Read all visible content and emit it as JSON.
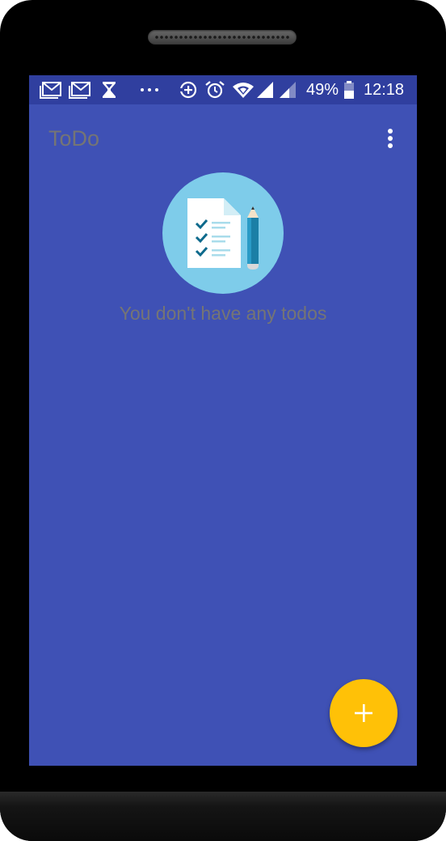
{
  "status_bar": {
    "icons": [
      "gmail-icon",
      "gmail-icon",
      "hourglass-icon",
      "more-dots-icon",
      "data-saver-icon",
      "alarm-icon",
      "wifi-icon",
      "signal-icon",
      "signal-icon",
      "battery-icon"
    ],
    "battery_percent": "49%",
    "time": "12:18"
  },
  "app_bar": {
    "title": "ToDo",
    "menu_icon": "more-vert-icon"
  },
  "empty_state": {
    "illustration": "checklist-pencil-icon",
    "message": "You don't have any todos"
  },
  "fab": {
    "icon": "plus-icon"
  },
  "colors": {
    "primary": "#3F51B5",
    "primary_dark": "#303F9F",
    "accent": "#FFC107",
    "text_muted": "#757575",
    "illustration_circle": "#7ECCEA"
  }
}
